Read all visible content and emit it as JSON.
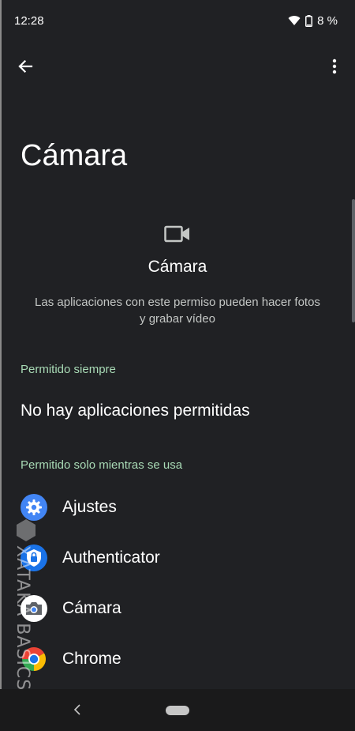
{
  "status_bar": {
    "time": "12:28",
    "battery": "8 %"
  },
  "app_bar": {
    "back_icon": "arrow-back-icon",
    "more_icon": "more-vert-icon"
  },
  "page": {
    "title": "Cámara",
    "header": {
      "icon": "videocam-icon",
      "title": "Cámara",
      "description": "Las aplicaciones con este permiso pueden hacer fotos y grabar vídeo"
    }
  },
  "sections": {
    "always": {
      "label": "Permitido siempre",
      "empty_text": "No hay aplicaciones permitidas"
    },
    "while_in_use": {
      "label": "Permitido solo mientras se usa",
      "apps": [
        {
          "label": "Ajustes",
          "icon": "settings-gear-icon"
        },
        {
          "label": "Authenticator",
          "icon": "authenticator-lock-icon"
        },
        {
          "label": "Cámara",
          "icon": "camera-app-icon"
        },
        {
          "label": "Chrome",
          "icon": "chrome-icon"
        }
      ]
    }
  },
  "watermark": "XATAKA BASICS",
  "colors": {
    "background": "#202124",
    "section_label": "#a8dab5",
    "text": "#ffffff"
  }
}
